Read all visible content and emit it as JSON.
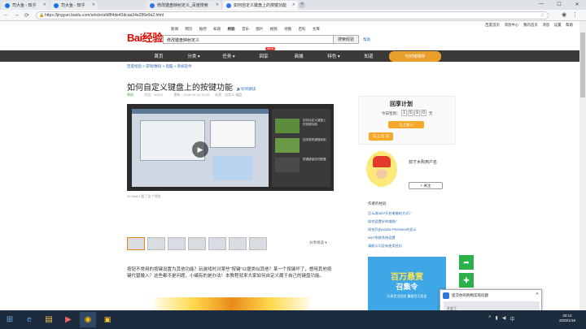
{
  "tabs": [
    {
      "label": "司大鱼 - 知乎"
    },
    {
      "label": "司大鱼 - 知乎"
    },
    {
      "label": "修改键盘映射定义_百度搜索"
    },
    {
      "label": "如何自定义键盘上的按键功能"
    }
  ],
  "address": {
    "url": "https://jingyan.baidu.com/article/afd8f4de43dcaa34e286e9a2.html"
  },
  "header": {
    "top_links": [
      "百度首页",
      "消息中心",
      "我的首页",
      "消息",
      "设置",
      "帮助"
    ],
    "nav_links": [
      "新闻",
      "网页",
      "贴吧",
      "知道",
      "经验",
      "音乐",
      "图片",
      "视频",
      "地图",
      "百科",
      "文库"
    ],
    "search_value": "修改键盘映射定义",
    "search_button": "搜索经验",
    "help": "帮助",
    "logo": "Bai经验"
  },
  "mainnav": {
    "items": [
      "首页",
      "分类 ▾",
      "任务 ▾",
      "回享",
      "商城",
      "特色 ▾",
      "知道"
    ],
    "new_badge": "NEW",
    "promo": "与时常相伴"
  },
  "breadcrumb": "百度经验 > 游戏/数码 > 电脑 > 系统软件",
  "article": {
    "title": "如何自定义键盘上的按键功能",
    "listen": "听听朗读",
    "meta_author": "原创",
    "meta_views": "浏览：30012",
    "meta_date": "更新：2018-09-26 12:53",
    "meta_tags": "标签：自定义  键盘",
    "caption": "313468人看了这个视频",
    "share": "分享阅读 ▾",
    "body": "按钮不常用的按键设置为其他功能？玩游戏时对某些\"按键\"以便类似其他？某一个按键坏了，想用其他按键代替输入？这些都不是问题，小编有的是办法！本教程就来大家如何自定义属于自己的键盘功能。"
  },
  "video_side": [
    "如何自定义键盘上的按键功能",
    "如何更改键盘映射",
    "按键键盘如何配置",
    "电脑键盘的使用方法"
  ],
  "right": {
    "brand": "回享计划",
    "today_label": "今日签到：",
    "counter": [
      "1",
      "5",
      "9",
      "0"
    ],
    "counter_unit": "元",
    "join_btn": "马上加入",
    "qa_btn": "马上 问 答",
    "user_name": "叔才木购用户名",
    "follow": "+ 关注",
    "list_title": "作者的经验",
    "list": [
      "怎么改win7开启电脑的方式？",
      "如何设置好的电脑？",
      "如何开启Adobe Premiere的显示",
      "win7系统系统设置",
      "请能公司没有使用经历"
    ],
    "ad_title": "百万悬赏",
    "ad_sub": "召集令",
    "ad_bottom": "分享生活经验 赢取百万奖金"
  },
  "toast": {
    "title": "提交你的购物实际问题",
    "sub": "开会了"
  },
  "taskbar": {
    "time": "20:12",
    "date": "2020/1/18"
  }
}
